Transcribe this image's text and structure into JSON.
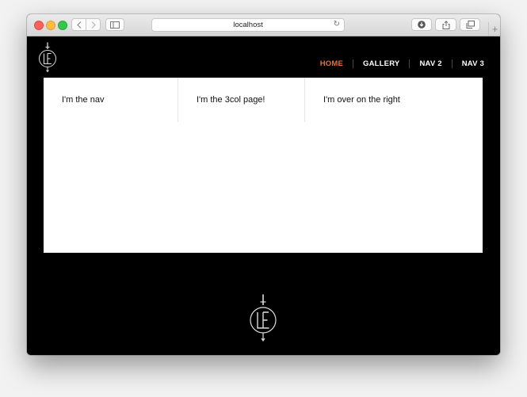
{
  "browser": {
    "address": "localhost",
    "nav_back_icon": "chevron-left-icon",
    "nav_forward_icon": "chevron-right-icon",
    "sidebar_icon": "sidebar-icon",
    "reload_icon": "reload-icon",
    "download_icon": "download-icon",
    "share_icon": "share-icon",
    "tabs_icon": "tabs-icon",
    "new_tab_label": "+"
  },
  "site": {
    "logo_icon": "le-dagger-logo",
    "nav": [
      {
        "label": "HOME",
        "active": true
      },
      {
        "label": "GALLERY",
        "active": false
      },
      {
        "label": "NAV 2",
        "active": false
      },
      {
        "label": "NAV 3",
        "active": false
      }
    ],
    "accent_color": "#f26a34",
    "columns": [
      {
        "text": "I'm the nav"
      },
      {
        "text": "I'm the 3col page!"
      },
      {
        "text": "I'm over on the right"
      }
    ]
  }
}
